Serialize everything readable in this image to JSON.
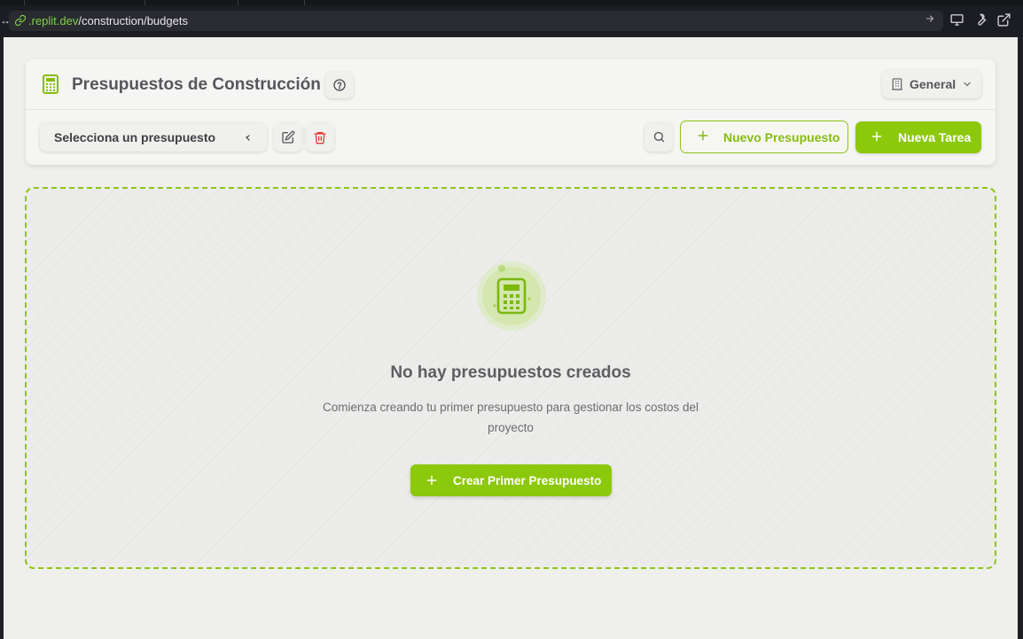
{
  "browser": {
    "url_host": ".replit.dev",
    "url_path": "/construction/budgets",
    "left_edge_glyph": "↔"
  },
  "header": {
    "title": "Presupuestos de Construcción",
    "title_icon": "calculator-icon",
    "help_icon": "help-circle-icon",
    "scope_label": "General",
    "scope_icon": "building-icon"
  },
  "toolbar": {
    "select_placeholder": "Selecciona un presupuesto",
    "edit_icon": "edit-icon",
    "delete_icon": "trash-icon",
    "search_icon": "search-icon",
    "new_budget_label": "Nuevo Presupuesto",
    "new_task_label": "Nueva Tarea"
  },
  "empty_state": {
    "icon": "calculator-icon",
    "title": "No hay presupuestos creados",
    "description": "Comienza creando tu primer presupuesto para gestionar los costos del proyecto",
    "cta_label": "Crear Primer Presupuesto"
  },
  "colors": {
    "accent": "#8cc80c",
    "accent_text": "#86bd10",
    "delete": "#e03a3a",
    "background": "#efefec"
  }
}
